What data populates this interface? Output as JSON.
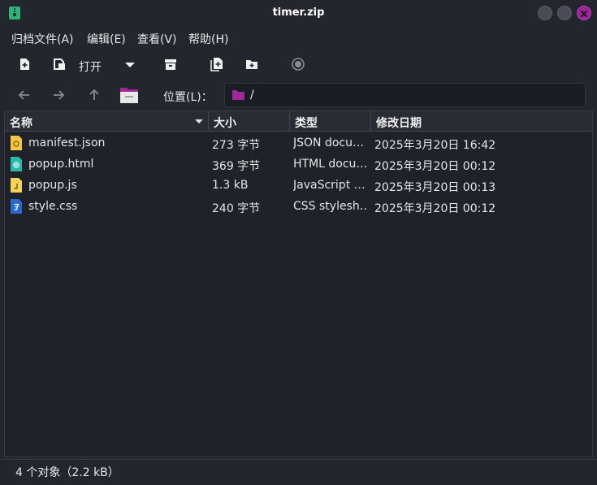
{
  "window": {
    "title": "timer.zip"
  },
  "menu": [
    "归档文件(A)",
    "编辑(E)",
    "查看(V)",
    "帮助(H)"
  ],
  "toolbar": {
    "open_label": "打开"
  },
  "location": {
    "label": "位置(L)：",
    "path": "/"
  },
  "columns": [
    "名称",
    "大小",
    "类型",
    "修改日期"
  ],
  "files": [
    {
      "name": "manifest.json",
      "size": "273 字节",
      "type": "JSON docu…",
      "modified": "2025年3月20日 16:42",
      "icon": "json-file-icon"
    },
    {
      "name": "popup.html",
      "size": "369 字节",
      "type": "HTML docu…",
      "modified": "2025年3月20日 00:12",
      "icon": "html-file-icon"
    },
    {
      "name": "popup.js",
      "size": "1.3 kB",
      "type": "JavaScript …",
      "modified": "2025年3月20日 00:13",
      "icon": "js-file-icon"
    },
    {
      "name": "style.css",
      "size": "240 字节",
      "type": "CSS stylesh…",
      "modified": "2025年3月20日 00:12",
      "icon": "css-file-icon"
    }
  ],
  "status": {
    "text": "4 个对象（2.2 kB）"
  },
  "colors": {
    "accent": "#a0249c",
    "folder": "#a02898",
    "background": "#24262e"
  }
}
